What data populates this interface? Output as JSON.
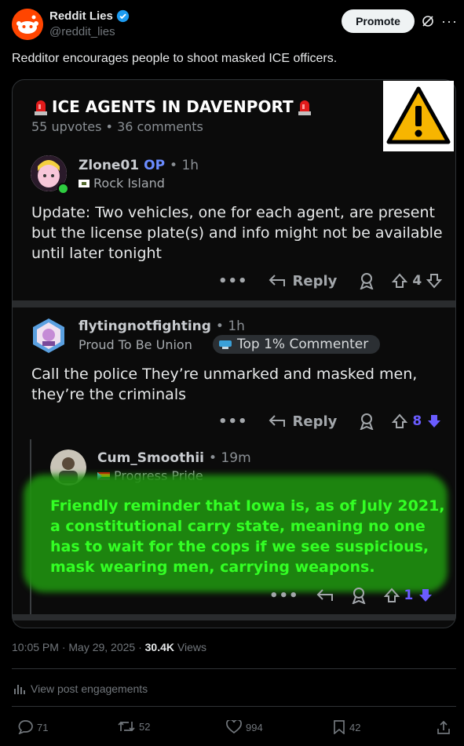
{
  "author": {
    "name": "Reddit Lies",
    "handle": "@reddit_lies",
    "verified": true
  },
  "promote_label": "Promote",
  "tweet_text": "Redditor encourages people to shoot masked ICE officers.",
  "reddit_post": {
    "title": "ICE AGENTS IN DAVENPORT",
    "meta": "55 upvotes • 36 comments",
    "comments": [
      {
        "username": "Zlone01",
        "op_label": "OP",
        "time": "• 1h",
        "flair": "Rock Island",
        "text": "Update: Two vehicles, one for each agent, are present but the license plate(s) and info might not be available until later tonight",
        "reply_label": "Reply",
        "votes": "4"
      },
      {
        "username": "flytingnotfighting",
        "time": "• 1h",
        "flair": "Proud To Be Union",
        "badge": "Top 1% Commenter",
        "text": "Call the police They’re unmarked and masked men, they’re the criminals",
        "reply_label": "Reply",
        "votes": "8"
      },
      {
        "username": "Cum_Smoothii",
        "time": "• 19m",
        "flair": "Progress Pride",
        "text": "Friendly reminder that Iowa is, as of July 2021, a constitutional carry state, meaning no one has to wait for the cops if we see suspicious, mask wearing men, carrying weapons.",
        "votes": "1"
      }
    ]
  },
  "footer": {
    "time": "10:05 PM · May 29, 2025 · ",
    "views_count": "30.4K",
    "views_label": " Views",
    "engagements_label": "View post engagements",
    "replies": "71",
    "reposts": "52",
    "likes": "994",
    "bookmarks": "42"
  },
  "colors": {
    "accent_blue": "#1d9bf0",
    "reddit_orange": "#ff4500",
    "op_blue": "#6b8cff",
    "downvote_purple": "#6a5cff",
    "highlight_green": "#33ff24"
  }
}
